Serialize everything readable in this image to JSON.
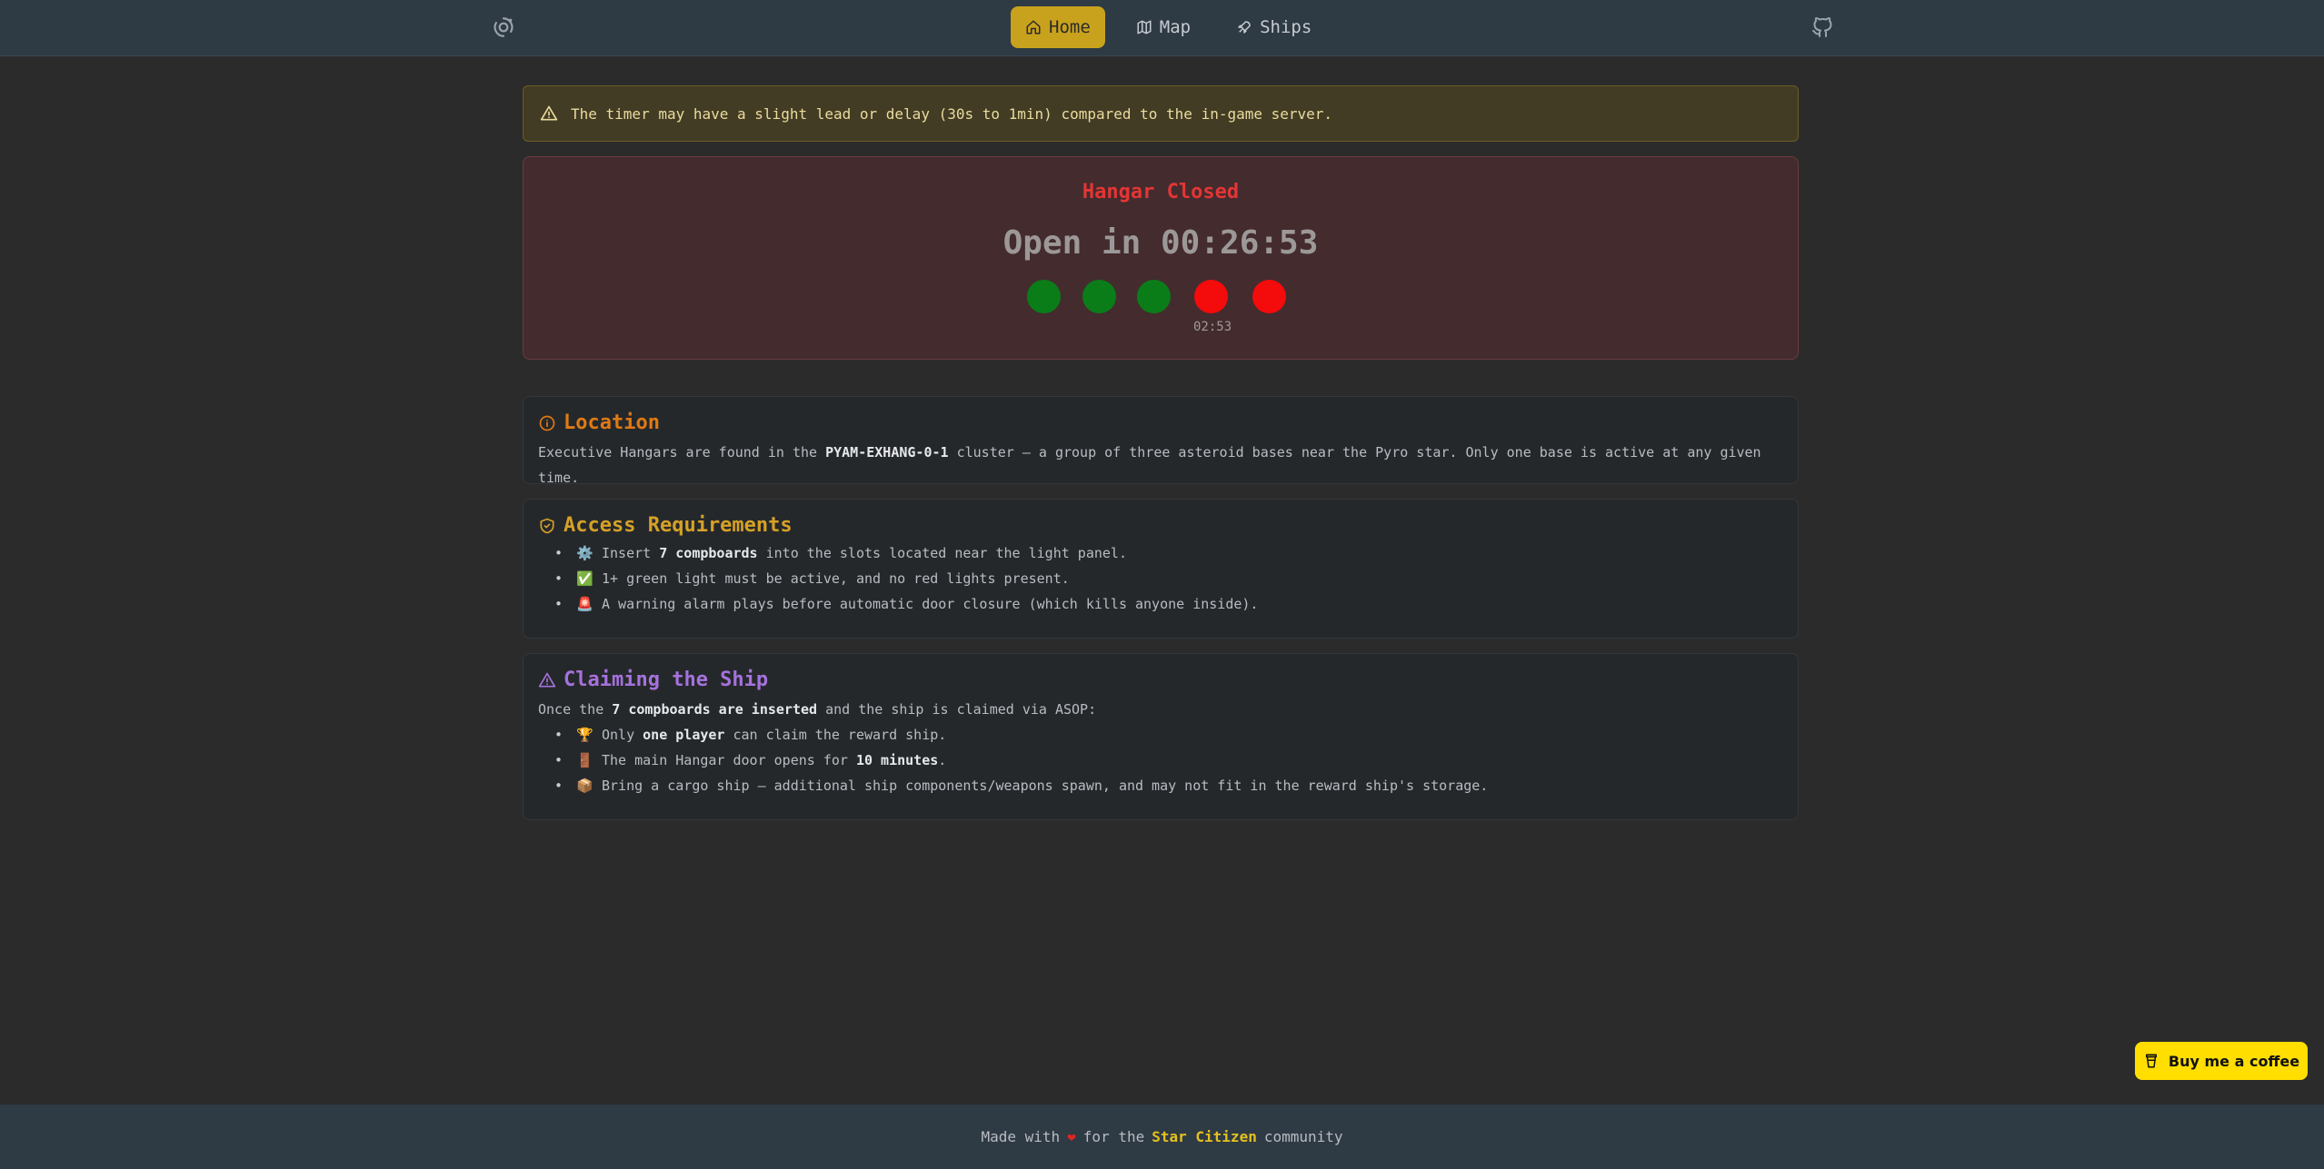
{
  "nav": {
    "items": [
      {
        "label": "Home",
        "icon": "home-icon",
        "active": true
      },
      {
        "label": "Map",
        "icon": "map-icon",
        "active": false
      },
      {
        "label": "Ships",
        "icon": "rocket-icon",
        "active": false
      }
    ]
  },
  "warning": {
    "text": "The timer may have a slight lead or delay (30s to 1min) compared to the in-game server."
  },
  "hangar": {
    "status": "Hangar Closed",
    "timer": "Open in 00:26:53",
    "lights": [
      "green",
      "green",
      "green",
      "red",
      "red"
    ],
    "light_timer": "02:53",
    "colors": {
      "green": "#0b7d18",
      "red": "#f40b0b",
      "status": "#e43535"
    }
  },
  "location": {
    "title": "Location",
    "text_before": "Executive Hangars are found in the ",
    "highlight": "PYAM-EXHANG-0-1",
    "text_after": " cluster — a group of three asteroid bases near the Pyro star. Only one base is active at any given time."
  },
  "access": {
    "title": "Access Requirements",
    "items": [
      {
        "emoji": "⚙️",
        "before": "Insert ",
        "bold": "7 compboards",
        "after": " into the slots located near the light panel."
      },
      {
        "emoji": "✅",
        "before": "1+ green light must be active, and no red lights present.",
        "bold": "",
        "after": ""
      },
      {
        "emoji": "🚨",
        "before": "A warning alarm plays before automatic door closure (which kills anyone inside).",
        "bold": "",
        "after": ""
      }
    ]
  },
  "claim": {
    "title": "Claiming the Ship",
    "intro_before": "Once the ",
    "intro_bold": "7 compboards are inserted",
    "intro_after": " and the ship is claimed via ASOP:",
    "items": [
      {
        "emoji": "🏆",
        "before": "Only ",
        "bold": "one player",
        "after": " can claim the reward ship."
      },
      {
        "emoji": "🚪",
        "before": "The main Hangar door opens for ",
        "bold": "10 minutes",
        "after": "."
      },
      {
        "emoji": "📦",
        "before": "Bring a cargo ship — additional ship components/weapons spawn, and may not fit in the reward ship's storage.",
        "bold": "",
        "after": ""
      }
    ]
  },
  "footer": {
    "before": "Made with",
    "heart": "❤",
    "middle": "for the",
    "brand": "Star Citizen",
    "after": "community"
  },
  "coffee": {
    "label": "Buy me a coffee"
  }
}
